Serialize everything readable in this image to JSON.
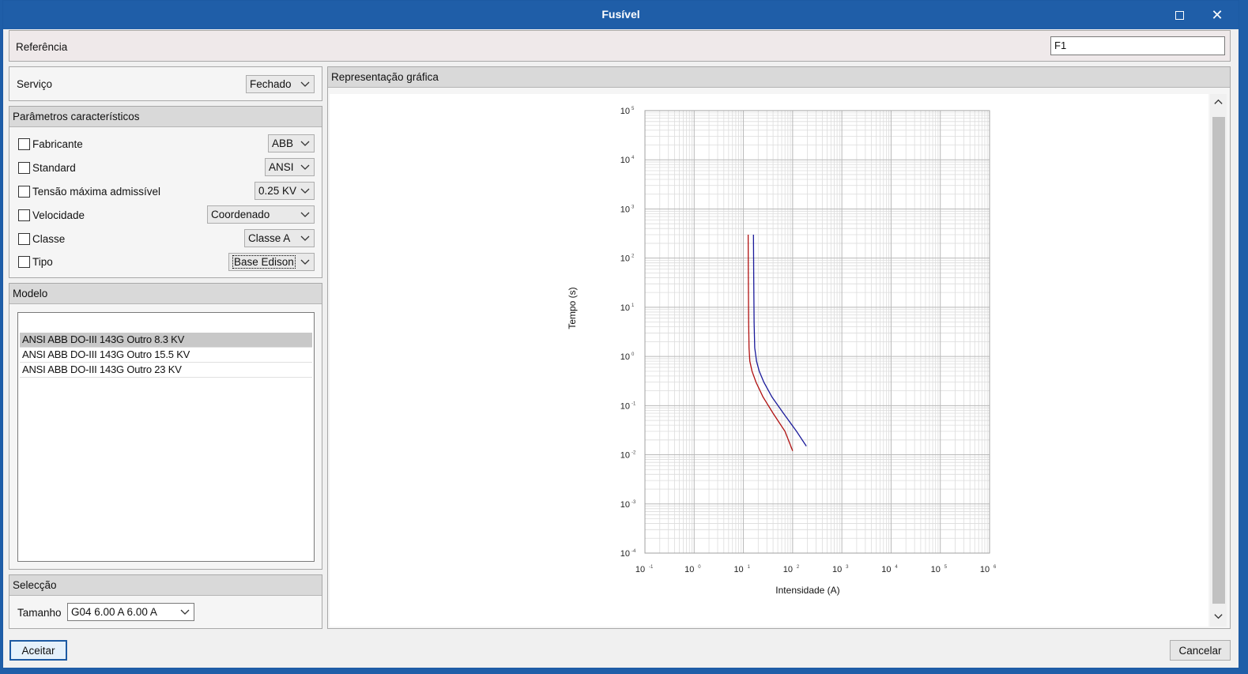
{
  "window": {
    "title": "Fusível"
  },
  "referencia": {
    "label": "Referência",
    "value": "F1"
  },
  "servico": {
    "label": "Serviço",
    "value": "Fechado"
  },
  "parametros": {
    "title": "Parâmetros característicos",
    "rows": [
      {
        "label": "Fabricante",
        "value": "ABB",
        "checked": false
      },
      {
        "label": "Standard",
        "value": "ANSI",
        "checked": false
      },
      {
        "label": "Tensão máxima admissível",
        "value": "0.25 KV",
        "checked": false
      },
      {
        "label": "Velocidade",
        "value": "Coordenado",
        "checked": false
      },
      {
        "label": "Classe",
        "value": "Classe A",
        "checked": false
      },
      {
        "label": "Tipo",
        "value": "Base Edison",
        "checked": false
      }
    ]
  },
  "modelo": {
    "title": "Modelo",
    "items": [
      {
        "label": "ANSI ABB DO-III 143G Outro 8.3 KV",
        "selected": true
      },
      {
        "label": "ANSI ABB DO-III 143G Outro 15.5 KV",
        "selected": false
      },
      {
        "label": "ANSI ABB DO-III 143G Outro 23 KV",
        "selected": false
      }
    ]
  },
  "seleccao": {
    "title": "Selecção",
    "label": "Tamanho",
    "value": "G04 6.00 A 6.00 A"
  },
  "grafica": {
    "title": "Representação gráfica"
  },
  "chart_data": {
    "type": "line",
    "title": "",
    "xlabel": "Intensidade (A)",
    "ylabel": "Tempo (s)",
    "x_scale": "log",
    "y_scale": "log",
    "xlim": [
      0.1,
      1000000
    ],
    "ylim": [
      0.0001,
      100000
    ],
    "x_ticks": [
      {
        "base": "10",
        "exp": "-1"
      },
      {
        "base": "10",
        "exp": "0"
      },
      {
        "base": "10",
        "exp": "1"
      },
      {
        "base": "10",
        "exp": "2"
      },
      {
        "base": "10",
        "exp": "3"
      },
      {
        "base": "10",
        "exp": "4"
      },
      {
        "base": "10",
        "exp": "5"
      },
      {
        "base": "10",
        "exp": "6"
      }
    ],
    "y_ticks": [
      {
        "base": "10",
        "exp": "5"
      },
      {
        "base": "10",
        "exp": "4"
      },
      {
        "base": "10",
        "exp": "3"
      },
      {
        "base": "10",
        "exp": "2"
      },
      {
        "base": "10",
        "exp": "1"
      },
      {
        "base": "10",
        "exp": "0"
      },
      {
        "base": "10",
        "exp": "-1"
      },
      {
        "base": "10",
        "exp": "-2"
      },
      {
        "base": "10",
        "exp": "-3"
      },
      {
        "base": "10",
        "exp": "-4"
      }
    ],
    "grid": true,
    "series": [
      {
        "color": "#b01010",
        "points": [
          [
            12.5,
            300
          ],
          [
            12.6,
            50
          ],
          [
            12.8,
            5
          ],
          [
            13,
            1.5
          ],
          [
            13.5,
            0.8
          ],
          [
            15,
            0.5
          ],
          [
            18,
            0.3
          ],
          [
            25,
            0.15
          ],
          [
            40,
            0.07
          ],
          [
            70,
            0.03
          ],
          [
            100,
            0.012
          ]
        ]
      },
      {
        "color": "#1a1a9a",
        "points": [
          [
            16,
            300
          ],
          [
            16.2,
            50
          ],
          [
            16.5,
            5
          ],
          [
            17,
            1.5
          ],
          [
            18.5,
            0.8
          ],
          [
            21,
            0.5
          ],
          [
            26,
            0.3
          ],
          [
            38,
            0.15
          ],
          [
            65,
            0.07
          ],
          [
            120,
            0.03
          ],
          [
            190,
            0.015
          ]
        ]
      }
    ]
  },
  "footer": {
    "accept": "Aceitar",
    "cancel": "Cancelar"
  },
  "icons": {
    "maximize": "maximize-icon",
    "close": "close-icon",
    "dropdown": "chevron-down-icon"
  }
}
